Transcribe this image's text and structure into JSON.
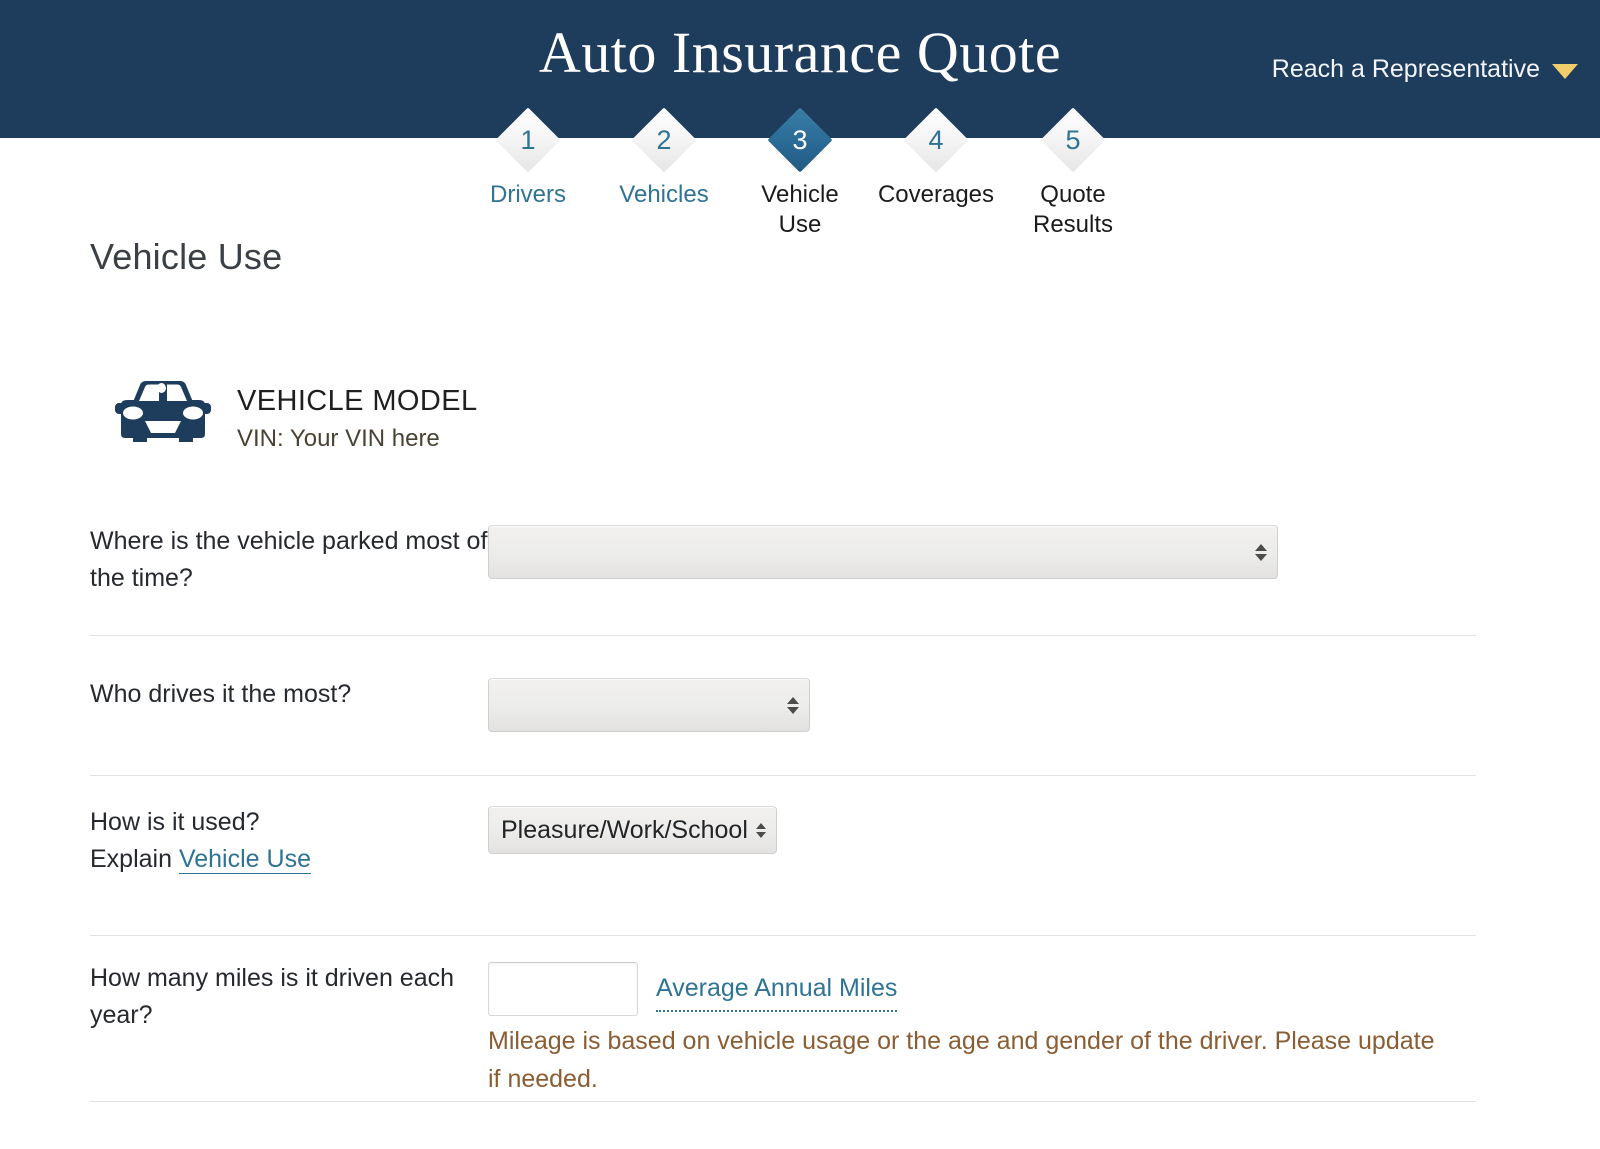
{
  "header": {
    "title": "Auto Insurance Quote",
    "rep_label": "Reach a Representative",
    "rep_icon": "chevron-down-icon",
    "bg_color": "#1e3c5c",
    "accent_color": "#f2cd6b"
  },
  "stepper": {
    "active_index": 3,
    "active_color": "#2a6a96",
    "link_color": "#2f7395",
    "steps": [
      {
        "number": "1",
        "label": "Drivers",
        "state": "completed",
        "label_color": "#2f7395"
      },
      {
        "number": "2",
        "label": "Vehicles",
        "state": "completed",
        "label_color": "#2f7395"
      },
      {
        "number": "3",
        "label": "Vehicle\nUse",
        "state": "active",
        "label_color": "#1b1b1b"
      },
      {
        "number": "4",
        "label": "Coverages",
        "state": "upcoming",
        "label_color": "#1b1b1b"
      },
      {
        "number": "5",
        "label": "Quote\nResults",
        "state": "upcoming",
        "label_color": "#1b1b1b"
      }
    ]
  },
  "main": {
    "page_title": "Vehicle Use",
    "vehicle": {
      "icon": "car-front-icon",
      "model": "VEHICLE MODEL",
      "vin": "VIN: Your VIN here",
      "vin_color": "#4a4334"
    },
    "rows": {
      "parked": {
        "label": "Where is the vehicle parked most of the time?",
        "select_value": "",
        "select_icon": "updown-arrows-icon"
      },
      "driver": {
        "label": "Who drives it the most?",
        "select_value": "",
        "select_icon": "updown-arrows-icon"
      },
      "usage": {
        "label": "How is it used?",
        "explain_prefix": "Explain",
        "explain_link": "Vehicle Use",
        "select_value": "Pleasure/Work/School",
        "select_icon": "updown-arrows-icon"
      },
      "mileage": {
        "label": "How many miles is it driven each year?",
        "input_value": "",
        "input_placeholder": "",
        "link": "Average Annual Miles",
        "note": "Mileage is based on vehicle usage or the age and gender of the driver. Please update if needed.",
        "note_color": "#8a5d33"
      }
    }
  }
}
